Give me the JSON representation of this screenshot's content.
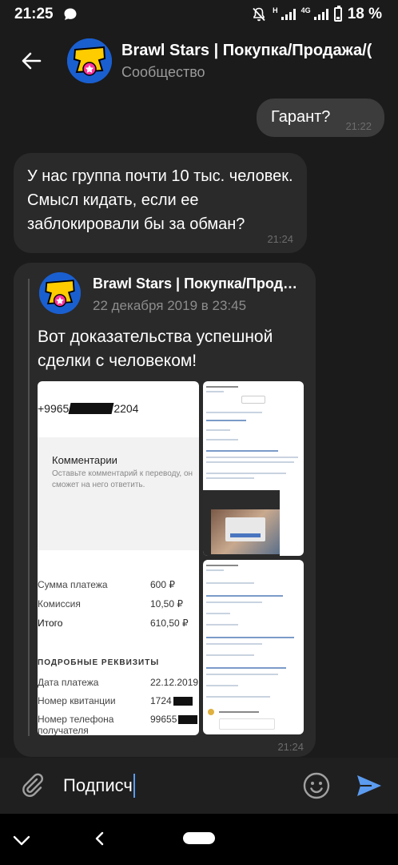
{
  "status": {
    "time": "21:25",
    "network": "4G",
    "battery": "18 %"
  },
  "header": {
    "title": "Brawl Stars | Покупка/Продажа/(",
    "subtitle": "Сообщество"
  },
  "messages": [
    {
      "direction": "out",
      "text": "Гарант?",
      "time": "21:22"
    },
    {
      "direction": "in",
      "text": "У нас группа почти 10 тыс. человек. Смысл кидать, если ее заблокировали бы за обман?",
      "time": "21:24"
    }
  ],
  "repost": {
    "author": "Brawl Stars | Покупка/Продажа/Обмен",
    "date": "22 декабря 2019 в 23:45",
    "text": "Вот доказательства успешной сделки с человеком!",
    "time": "21:24",
    "photo": {
      "phone_start": "+9965",
      "phone_end": "2204",
      "comments_title": "Комментарии",
      "comments_hint": "Оставьте комментарий к переводу, он сможет на него ответить.",
      "rows": [
        {
          "label": "Сумма платежа",
          "value": "600 ₽"
        },
        {
          "label": "Комиссия",
          "value": "10,50 ₽"
        },
        {
          "label": "Итого",
          "value": "610,50 ₽"
        }
      ],
      "details_title": "ПОДРОБНЫЕ РЕКВИЗИТЫ",
      "details": [
        {
          "label": "Дата платежа",
          "value": "22.12.2019"
        },
        {
          "label": "Номер квитанции",
          "value": "1724"
        },
        {
          "label": "Номер телефона получателя",
          "value": "99655"
        }
      ]
    }
  },
  "input": {
    "text": "Подписч"
  },
  "colors": {
    "background": "#1b1b1b",
    "bubble_out": "#3c3c3c",
    "bubble_in": "#2a2a2a",
    "accent": "#5b9bf0"
  },
  "icons": [
    "back-arrow-icon",
    "paperclip-icon",
    "emoji-icon",
    "send-icon",
    "nav-down-icon",
    "nav-back-icon"
  ]
}
